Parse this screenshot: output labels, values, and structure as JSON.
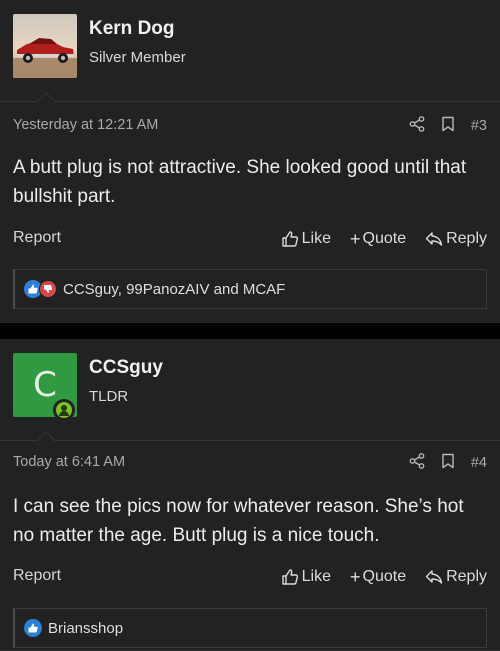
{
  "posts": [
    {
      "author": "Kern Dog",
      "user_title": "Silver Member",
      "avatar_type": "photo-car-icon",
      "timestamp": "Yesterday at 12:21 AM",
      "post_number": "#3",
      "message": "A butt plug is not attractive. She looked good until that bullshit part.",
      "actions": {
        "report": "Report",
        "like": "Like",
        "quote": "Quote",
        "reply": "Reply"
      },
      "reactions": "CCSguy, 99PanozAIV and MCAF"
    },
    {
      "author": "CCSguy",
      "user_title": "TLDR",
      "avatar_letter": "C",
      "avatar_color": "#2f9a41",
      "timestamp": "Today at 6:41 AM",
      "post_number": "#4",
      "message": "I can see the pics now for whatever reason. She’s hot no matter the age. Butt plug is a nice touch.",
      "actions": {
        "report": "Report",
        "like": "Like",
        "quote": "Quote",
        "reply": "Reply"
      },
      "reactions": "Briansshop"
    }
  ],
  "colors": {
    "background": "#000000",
    "card": "#222222",
    "like_blue": "#2e7fd6",
    "dislike_red": "#d94848",
    "online_green": "#7fbf2a"
  }
}
